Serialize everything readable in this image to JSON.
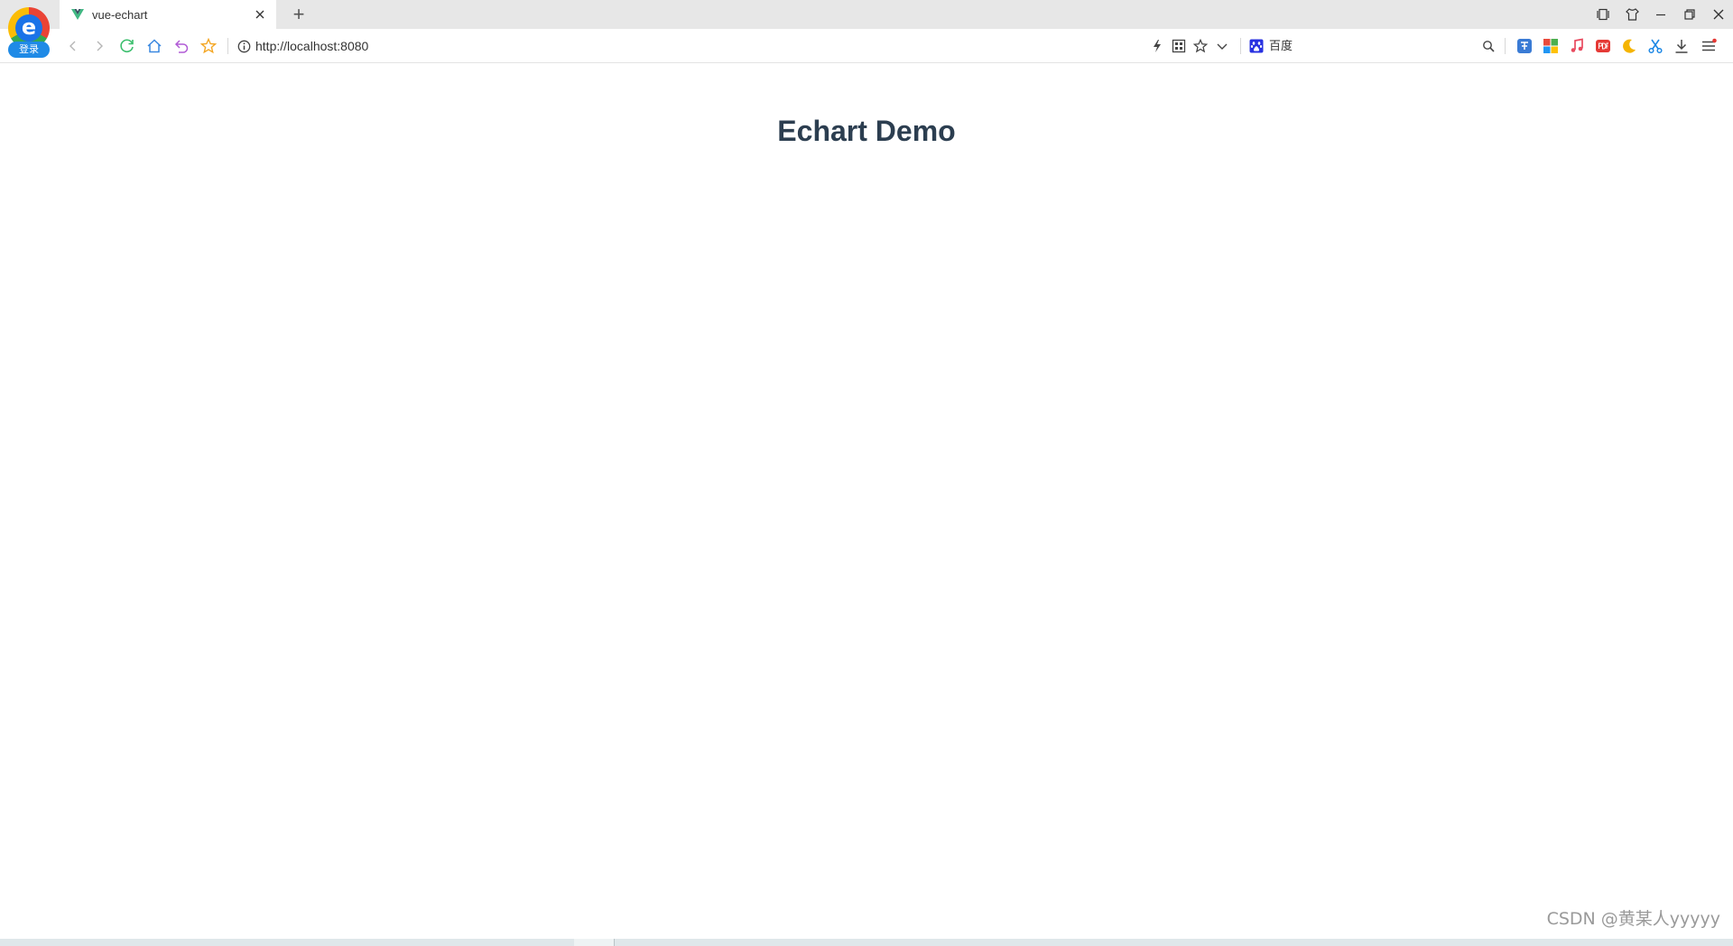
{
  "browser": {
    "logo_badge": "登录",
    "logo_letter": "e",
    "tab": {
      "title": "vue-echart"
    },
    "new_tab_label": "+",
    "address": {
      "url": "http://localhost:8080"
    },
    "search": {
      "placeholder": "百度"
    }
  },
  "page": {
    "title": "Echart Demo",
    "watermark": "CSDN @黄某人yyyyy"
  },
  "colors": {
    "title": "#2c3e50",
    "tab_strip": "#e7e7e7",
    "vue_green": "#41b883",
    "vue_dark": "#34495e"
  }
}
